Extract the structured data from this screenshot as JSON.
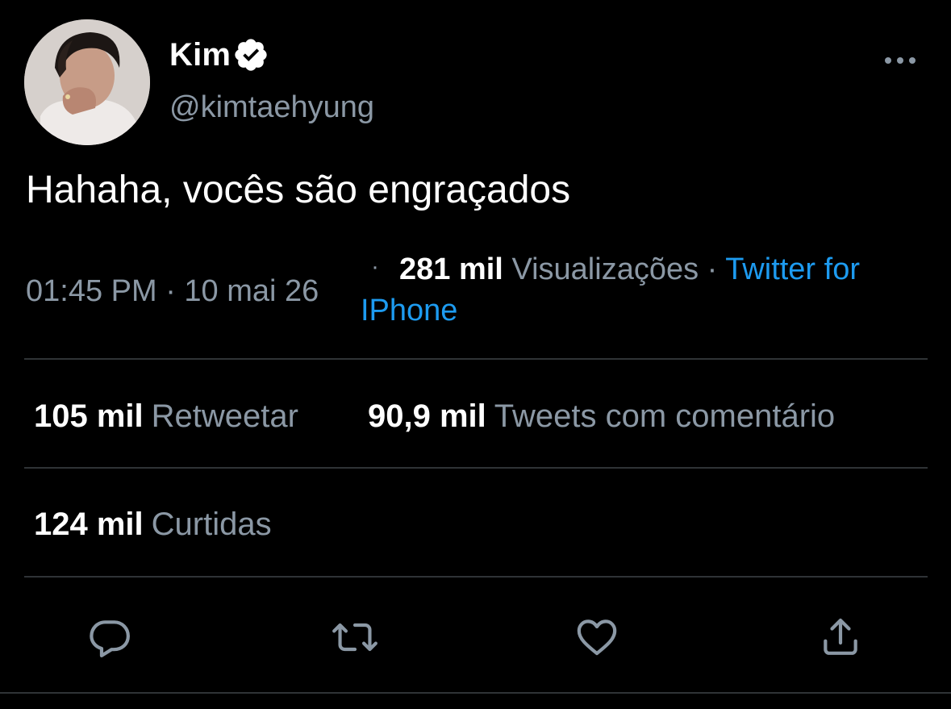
{
  "author": {
    "display_name": "Kim",
    "handle": "@kimtaehyung",
    "verified_icon": "verified-badge-icon",
    "avatar_icon": "profile-photo"
  },
  "tweet": {
    "text": "Hahaha, vocês são engraçados"
  },
  "meta": {
    "time_date": "01:45 PM · 10 mai 26",
    "separator": "·",
    "views_count": "281 mil",
    "views_label": "Visualizações",
    "separator2": "·",
    "source_part1": "Twitter for",
    "source_part2": "IPhone"
  },
  "stats": {
    "retweets_count": "105 mil",
    "retweets_label": "Retweetar",
    "quotes_count": "90,9 mil",
    "quotes_label": "Tweets com comentário",
    "likes_count": "124 mil",
    "likes_label": "Curtidas"
  },
  "actions": {
    "reply_icon": "reply-icon",
    "retweet_icon": "retweet-icon",
    "like_icon": "heart-icon",
    "share_icon": "share-icon"
  },
  "colors": {
    "background": "#000000",
    "primary_text": "#ffffff",
    "secondary_text": "#8b98a5",
    "link": "#1d9bf0",
    "divider": "#2f3336"
  }
}
